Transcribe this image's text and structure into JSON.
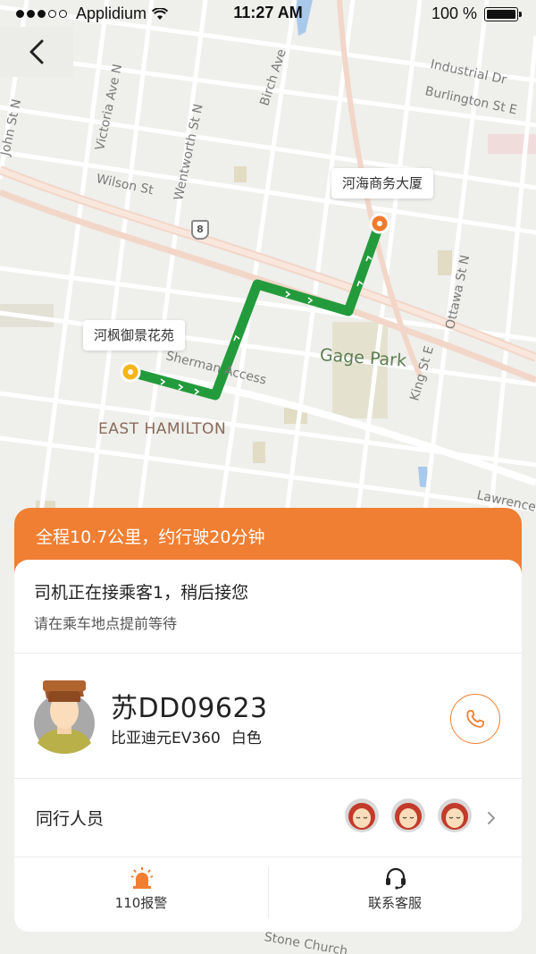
{
  "status_bar": {
    "carrier": "Applidium",
    "time": "11:27 AM",
    "battery": "100 %",
    "signal_bars_filled": 3,
    "signal_bars_total": 5,
    "battery_level": 1.0
  },
  "map": {
    "street_labels": [
      "Industrial Dr",
      "Burlington St E",
      "Birch Ave",
      "Wilson St",
      "Victoria Ave N",
      "Wentworth St N",
      "John St N",
      "Sherman Access",
      "Ottawa St N",
      "King St E",
      "Lawrence",
      "Gage Park",
      "EAST HAMILTON",
      "Stone Church"
    ],
    "route_shield": "8",
    "route_color": "#239b3c",
    "origin_color": "#f5b51c",
    "destination_color": "#ef7a2d"
  },
  "origin_tag": "河枫御景花苑",
  "destination_tag": "河海商务大厦",
  "trip": {
    "summary": "全程10.7公里，约行驶20分钟"
  },
  "notice": {
    "title": "司机正在接乘客1，稍后接您",
    "subtitle": "请在乘车地点提前等待"
  },
  "driver": {
    "plate": "苏DD09623",
    "car_model": "比亚迪元EV360",
    "car_color": "白色"
  },
  "companions": {
    "label": "同行人员",
    "count": 3
  },
  "actions": {
    "police_label": "110报警",
    "service_label": "联系客服"
  },
  "colors": {
    "accent": "#f07f33"
  }
}
